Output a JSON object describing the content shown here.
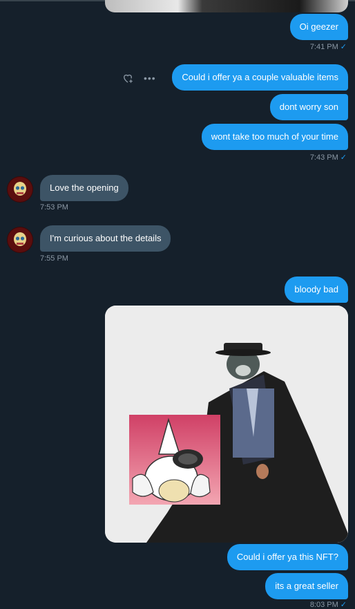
{
  "messages": {
    "m1": "Oi geezer",
    "t1": "7:41 PM",
    "m2": "Could i offer ya a couple valuable items",
    "m3": "dont worry son",
    "m4": "wont take too much of your time",
    "t2": "7:43 PM",
    "m5": "Love the opening",
    "t3": "7:53 PM",
    "m6": "I'm curious about the details",
    "t4": "7:55 PM",
    "m7": "bloody bad",
    "m8": "Could i offer ya this NFT?",
    "m9": "its a great seller",
    "t5": "8:03 PM"
  },
  "icons": {
    "react": "heart-plus-icon",
    "more": "more-icon",
    "check": "check-icon"
  },
  "colors": {
    "background": "#15202b",
    "outgoing_bubble": "#1d9bf0",
    "incoming_bubble": "#3d5466",
    "timestamp": "#8b98a5"
  }
}
